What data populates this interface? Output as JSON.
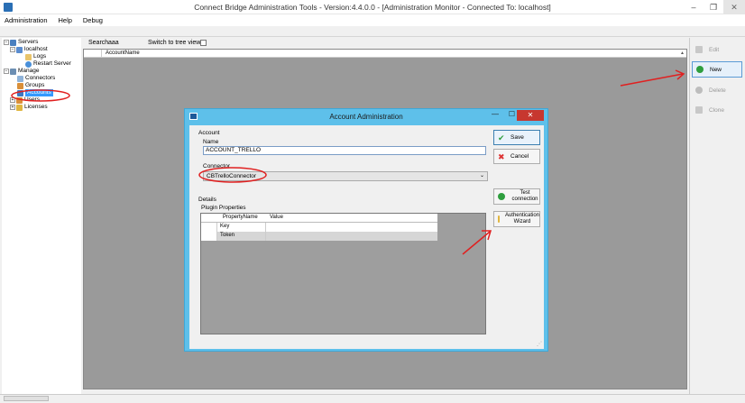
{
  "window": {
    "title": "Connect Bridge Administration Tools - Version:4.4.0.0 - [Administration Monitor - Connected To: localhost]"
  },
  "menu": [
    "Administration",
    "Help",
    "Debug"
  ],
  "tree": {
    "servers": "Servers",
    "localhost": "localhost",
    "logs": "Logs",
    "restart": "Restart Server",
    "manage": "Manage",
    "connectors": "Connectors",
    "groups": "Groups",
    "accounts": "Accounts",
    "users": "Users",
    "licenses": "Licenses"
  },
  "search": {
    "label": "Search",
    "value": "aaa",
    "tree_view_label": "Switch to tree view"
  },
  "grid": {
    "column": "AccountName"
  },
  "actions": {
    "edit": "Edit",
    "new": "New",
    "delete": "Delete",
    "clone": "Clone"
  },
  "dialog": {
    "title": "Account Administration",
    "group_account": "Account",
    "name_label": "Name",
    "name_value": "ACCOUNT_TRELLO",
    "connector_label": "Connector",
    "connector_value": "CBTrelloConnector",
    "details_label": "Details",
    "plugin_label": "Plugin Properties",
    "col_property": "PropertyName",
    "col_value": "Value",
    "rows": [
      {
        "key": "Key"
      },
      {
        "key": "Token"
      }
    ],
    "save": "Save",
    "cancel": "Cancel",
    "test_line1": "Test",
    "test_line2": "connection",
    "auth_line1": "Authentication",
    "auth_line2": "Wizard"
  },
  "colors": {
    "dialog_frame": "#5ec0ea",
    "close": "#c7372f",
    "annotation": "#e02020",
    "selection": "#3399ff"
  }
}
